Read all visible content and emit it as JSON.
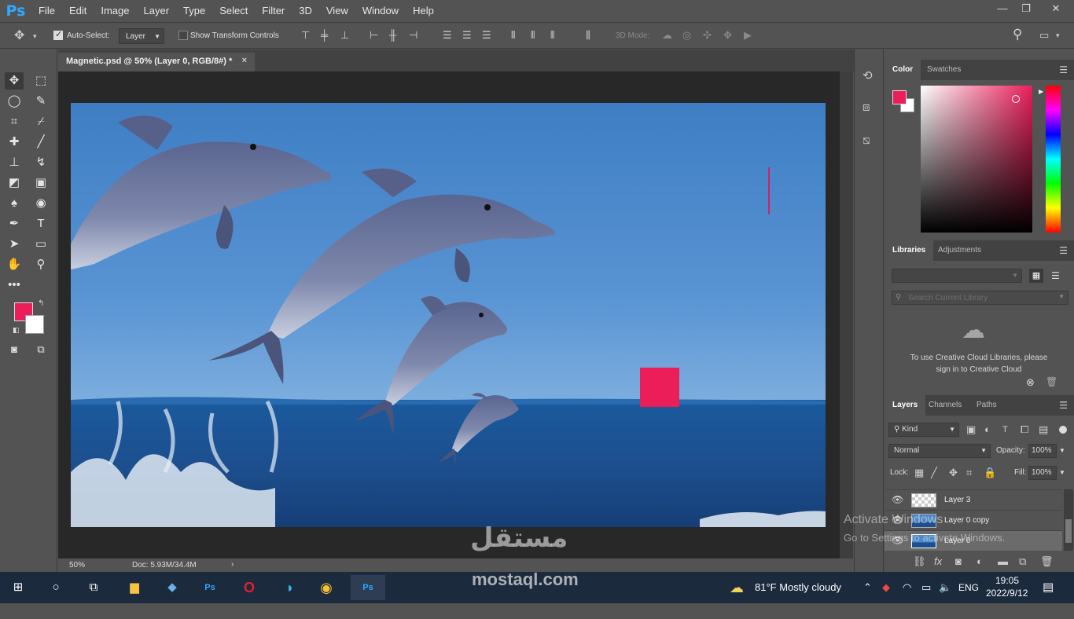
{
  "app": {
    "logo": "Ps",
    "colors": {
      "accent": "#31a8ff",
      "foreground": "#eb1e5a",
      "background": "#ffffff",
      "panel": "#535353"
    }
  },
  "menu": [
    "File",
    "Edit",
    "Image",
    "Layer",
    "Type",
    "Select",
    "Filter",
    "3D",
    "View",
    "Window",
    "Help"
  ],
  "options": {
    "auto_select_label": "Auto-Select:",
    "auto_select_value": "Layer",
    "show_transform_label": "Show Transform Controls",
    "mode_3d_label": "3D Mode:"
  },
  "document": {
    "tab_title": "Magnetic.psd @ 50% (Layer 0, RGB/8#) *",
    "close": "×"
  },
  "status": {
    "zoom": "50%",
    "doc_size": "Doc: 5.93M/34.4M",
    "arrow": "›"
  },
  "color_panel": {
    "tabs": [
      "Color",
      "Swatches"
    ]
  },
  "libraries_panel": {
    "tabs": [
      "Libraries",
      "Adjustments"
    ],
    "search_placeholder": "Search Current Library",
    "message": "To use Creative Cloud Libraries, please sign in to Creative Cloud"
  },
  "layers_panel": {
    "tabs": [
      "Layers",
      "Channels",
      "Paths"
    ],
    "filter": "Kind",
    "blend_mode": "Normal",
    "opacity_label": "Opacity:",
    "opacity": "100%",
    "lock_label": "Lock:",
    "fill_label": "Fill:",
    "fill": "100%",
    "layers": [
      {
        "name": "Layer 3"
      },
      {
        "name": "Layer 0 copy"
      },
      {
        "name": "Layer 0"
      }
    ]
  },
  "watermark": {
    "activate_title": "Activate Windows",
    "activate_sub": "Go to Settings to activate Windows.",
    "brand": "مستقل",
    "brand_url": "mostaql.com"
  },
  "taskbar": {
    "weather": "81°F  Mostly cloudy",
    "lang": "ENG",
    "time": "19:05",
    "date": "2022/9/12"
  }
}
